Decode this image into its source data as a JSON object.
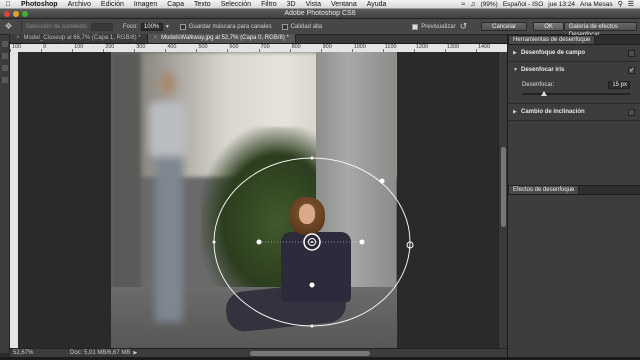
{
  "menubar": {
    "app": "Photoshop",
    "items": [
      "Archivo",
      "Edición",
      "Imagen",
      "Capa",
      "Texto",
      "Selección",
      "Filtro",
      "3D",
      "Vista",
      "Ventana",
      "Ayuda"
    ],
    "battery": "(99%)",
    "language": "Español - ISO",
    "clock": "jue 13:24",
    "user": "Ana Mesas"
  },
  "window": {
    "title": "Adobe Photoshop CS6"
  },
  "options": {
    "selection_label": "Selección de sureleido:",
    "focus_label": "Foco:",
    "focus_value": "100%",
    "save_mask_label": "Guardar máscara para canales",
    "high_quality_label": "Calidad alta",
    "preview_label": "Previsualizar",
    "cancel_label": "Cancelar",
    "ok_label": "OK",
    "gallery_label": "Galería de efectos Desenfocar"
  },
  "tabs": [
    "Model_Closeup al 66,7% (Capa 1, RGB/8) *",
    "ModelsWalkway.jpg al 52,7% (Capa 0, RGB/8) *"
  ],
  "ruler": {
    "ticks": [
      "100",
      "0",
      "100",
      "200",
      "300",
      "400",
      "500",
      "600",
      "700",
      "800",
      "900",
      "1000",
      "1100",
      "1200",
      "1300",
      "1400"
    ]
  },
  "statusbar": {
    "zoom": "52,67%",
    "doc": "Doc: 5,01 MB/6,67 MB"
  },
  "panel": {
    "tab": "Herramientas de desenfoque",
    "sections": [
      {
        "title": "Desenfoque de campo",
        "expanded": false,
        "checked": false
      },
      {
        "title": "Desenfocar iris",
        "expanded": true,
        "checked": true
      },
      {
        "title": "Cambio de inclinación",
        "expanded": false,
        "checked": false
      }
    ],
    "blur_label": "Desenfocar:",
    "blur_value": "15 px",
    "blur_fraction": 0.2,
    "effects_tab": "Efectos de desenfoque"
  },
  "colors": {
    "accent": "#4a4a4a",
    "close": "#e0443e",
    "minimize": "#e0a22c",
    "maximize": "#3fae3c"
  }
}
